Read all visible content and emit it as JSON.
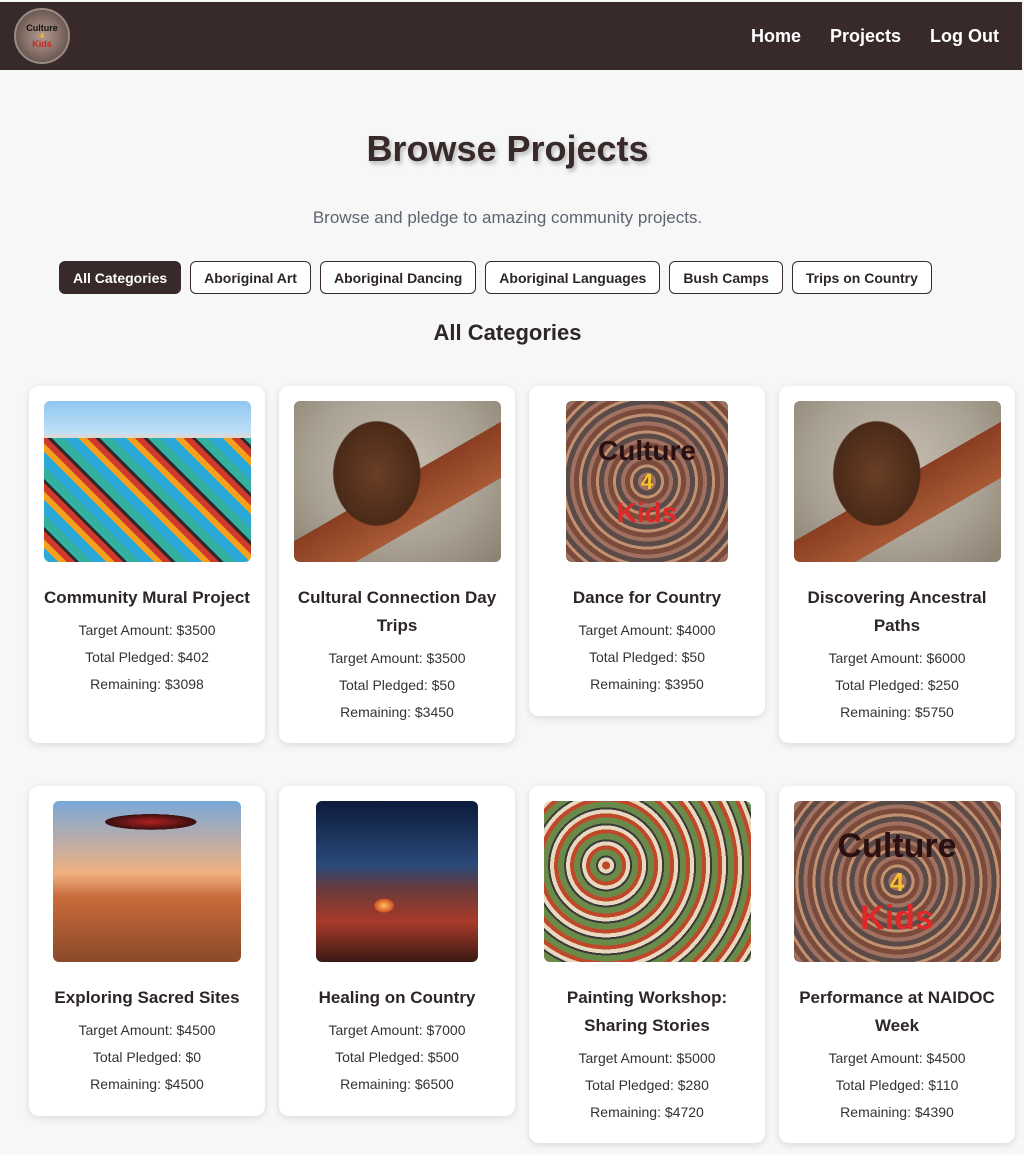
{
  "nav": {
    "logo_lines": [
      "Culture",
      "4",
      "Kids"
    ],
    "links": [
      "Home",
      "Projects",
      "Log Out"
    ]
  },
  "header": {
    "title": "Browse Projects",
    "subtitle": "Browse and pledge to amazing community projects."
  },
  "filters": [
    "All Categories",
    "Aboriginal Art",
    "Aboriginal Dancing",
    "Aboriginal Languages",
    "Bush Camps",
    "Trips on Country"
  ],
  "active_filter": "All Categories",
  "section_title": "All Categories",
  "projects": [
    {
      "title": "Community Mural Project",
      "target": "Target Amount: $3500",
      "pledged": "Total Pledged: $402",
      "remaining": "Remaining: $3098",
      "image": "mural-wall-image"
    },
    {
      "title": "Cultural Connection Day Trips",
      "target": "Target Amount: $3500",
      "pledged": "Total Pledged: $50",
      "remaining": "Remaining: $3450",
      "image": "didgeridoo-player-image"
    },
    {
      "title": "Dance for Country",
      "target": "Target Amount: $4000",
      "pledged": "Total Pledged: $50",
      "remaining": "Remaining: $3950",
      "image": "culture-4-kids-logo-image",
      "image_text": [
        "Culture",
        "4",
        "Kids"
      ]
    },
    {
      "title": "Discovering Ancestral Paths",
      "target": "Target Amount: $6000",
      "pledged": "Total Pledged: $250",
      "remaining": "Remaining: $5750",
      "image": "didgeridoo-player-image"
    },
    {
      "title": "Exploring Sacred Sites",
      "target": "Target Amount: $4500",
      "pledged": "Total Pledged: $0",
      "remaining": "Remaining: $4500",
      "image": "boomerang-children-image"
    },
    {
      "title": "Healing on Country",
      "target": "Target Amount: $7000",
      "pledged": "Total Pledged: $500",
      "remaining": "Remaining: $6500",
      "image": "night-camp-image"
    },
    {
      "title": "Painting Workshop: Sharing Stories",
      "target": "Target Amount: $5000",
      "pledged": "Total Pledged: $280",
      "remaining": "Remaining: $4720",
      "image": "painting-workshop-image"
    },
    {
      "title": "Performance at NAIDOC Week",
      "target": "Target Amount: $4500",
      "pledged": "Total Pledged: $110",
      "remaining": "Remaining: $4390",
      "image": "culture-4-kids-logo-image",
      "image_text": [
        "Culture",
        "4",
        "Kids"
      ]
    }
  ]
}
